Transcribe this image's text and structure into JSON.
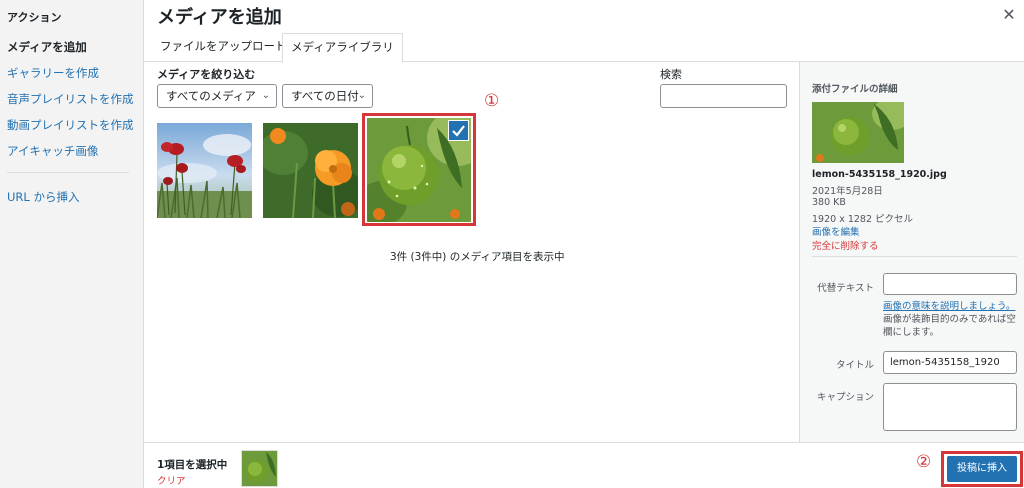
{
  "sidebar": {
    "heading": "アクション",
    "items": [
      {
        "label": "メディアを追加"
      },
      {
        "label": "ギャラリーを作成"
      },
      {
        "label": "音声プレイリストを作成"
      },
      {
        "label": "動画プレイリストを作成"
      },
      {
        "label": "アイキャッチ画像"
      },
      {
        "label": "URL から挿入"
      }
    ]
  },
  "header": {
    "title": "メディアを追加",
    "close_icon": "close-icon"
  },
  "tabs": [
    {
      "label": "ファイルをアップロード"
    },
    {
      "label": "メディアライブラリ"
    }
  ],
  "filter": {
    "label": "メディアを絞り込む",
    "type_select": "すべてのメディア",
    "date_select": "すべての日付"
  },
  "search": {
    "label": "検索",
    "value": ""
  },
  "annotations": {
    "marker1": "①",
    "marker2": "②"
  },
  "media_count": "3件 (3件中) のメディア項目を表示中",
  "details": {
    "heading": "添付ファイルの詳細",
    "filename": "lemon-5435158_1920.jpg",
    "date": "2021年5月28日",
    "size": "380 KB",
    "dimensions": "1920 x 1282 ピクセル",
    "edit_link": "画像を編集",
    "delete_link": "完全に削除する",
    "alt_label": "代替テキスト",
    "alt_value": "",
    "alt_help_link": "画像の意味を説明しましょう。",
    "alt_help_text": "画像が装飾目的のみであれば空欄にします。",
    "title_label": "タイトル",
    "title_value": "lemon-5435158_1920",
    "caption_label": "キャプション",
    "caption_value": ""
  },
  "bottom": {
    "selected_count": "1項目を選択中",
    "clear": "クリア",
    "insert_button": "投稿に挿入"
  },
  "colors": {
    "accent": "#2271b1",
    "highlight_red": "#d63638"
  }
}
